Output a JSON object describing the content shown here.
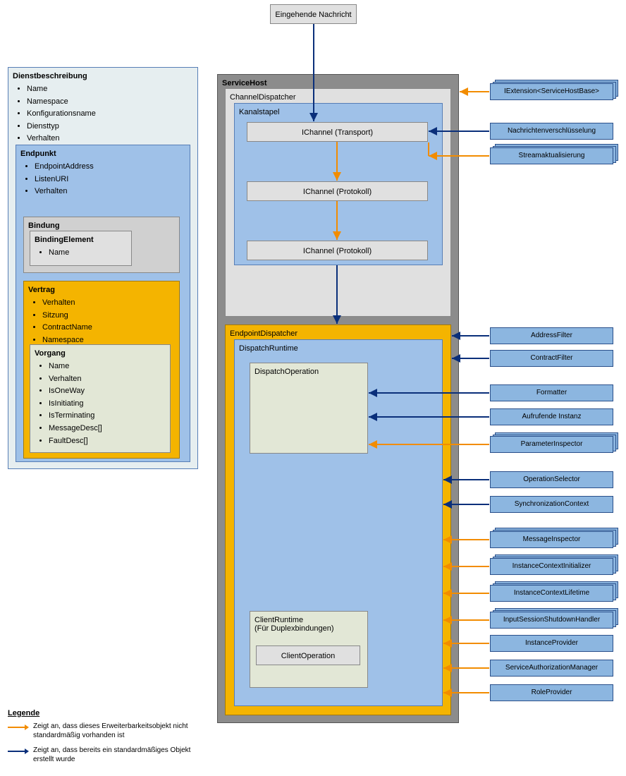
{
  "incoming": "Eingehende Nachricht",
  "serviceHost": "ServiceHost",
  "channelDispatcher": "ChannelDispatcher",
  "kanalstapel": "Kanalstapel",
  "ichannelTransport": "IChannel (Transport)",
  "ichannelProtocol1": "IChannel (Protokoll)",
  "ichannelProtocol2": "IChannel (Protokoll)",
  "endpointDispatcher": "EndpointDispatcher",
  "dispatchRuntime": "DispatchRuntime",
  "dispatchOperation": "DispatchOperation",
  "clientRuntime": {
    "line1": "ClientRuntime",
    "line2": "(Für Duplexbindungen)"
  },
  "clientOperation": "ClientOperation",
  "desc": {
    "title": "Dienstbeschreibung",
    "items": [
      "Name",
      "Namespace",
      "Konfigurationsname",
      "Diensttyp",
      "Verhalten"
    ]
  },
  "endpoint": {
    "title": "Endpunkt",
    "items": [
      "EndpointAddress",
      "ListenURI",
      "Verhalten"
    ]
  },
  "binding": {
    "title": "Bindung"
  },
  "bindingElement": {
    "title": "BindingElement",
    "items": [
      "Name"
    ]
  },
  "contract": {
    "title": "Vertrag",
    "items": [
      "Verhalten",
      "Sitzung",
      "ContractName",
      "Namespace"
    ]
  },
  "operation": {
    "title": "Vorgang",
    "items": [
      "Name",
      "Verhalten",
      "IsOneWay",
      "IsInitiating",
      "IsTerminating",
      "MessageDesc[]",
      "FaultDesc[]"
    ]
  },
  "ext": {
    "iextension": "IExtension<ServiceHostBase>",
    "msgEncrypt": "Nachrichtenverschlüsselung",
    "streamUpdate": "Streamaktualisierung",
    "addressFilter": "AddressFilter",
    "contractFilter": "ContractFilter",
    "formatter": "Formatter",
    "invoker": "Aufrufende Instanz",
    "paramInspector": "ParameterInspector",
    "opSelector": "OperationSelector",
    "syncContext": "SynchronizationContext",
    "msgInspector": "MessageInspector",
    "ictxInit": "InstanceContextInitializer",
    "ictxLifetime": "InstanceContextLifetime",
    "inputShutdown": "InputSessionShutdownHandler",
    "instanceProvider": "InstanceProvider",
    "svcAuthMgr": "ServiceAuthorizationManager",
    "roleProvider": "RoleProvider"
  },
  "legend": {
    "title": "Legende",
    "orange": "Zeigt an, dass dieses Erweiterbarkeitsobjekt nicht standardmäßig vorhanden ist",
    "blue": "Zeigt an, dass bereits ein standardmäßiges Objekt erstellt wurde"
  }
}
